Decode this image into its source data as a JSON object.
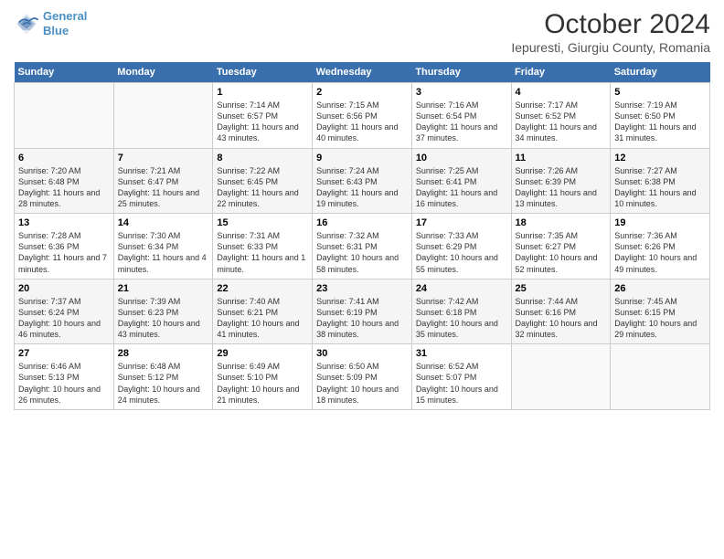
{
  "logo": {
    "line1": "General",
    "line2": "Blue"
  },
  "title": "October 2024",
  "subtitle": "Iepuresti, Giurgiu County, Romania",
  "headers": [
    "Sunday",
    "Monday",
    "Tuesday",
    "Wednesday",
    "Thursday",
    "Friday",
    "Saturday"
  ],
  "weeks": [
    [
      {
        "day": "",
        "info": ""
      },
      {
        "day": "",
        "info": ""
      },
      {
        "day": "1",
        "info": "Sunrise: 7:14 AM\nSunset: 6:57 PM\nDaylight: 11 hours and 43 minutes."
      },
      {
        "day": "2",
        "info": "Sunrise: 7:15 AM\nSunset: 6:56 PM\nDaylight: 11 hours and 40 minutes."
      },
      {
        "day": "3",
        "info": "Sunrise: 7:16 AM\nSunset: 6:54 PM\nDaylight: 11 hours and 37 minutes."
      },
      {
        "day": "4",
        "info": "Sunrise: 7:17 AM\nSunset: 6:52 PM\nDaylight: 11 hours and 34 minutes."
      },
      {
        "day": "5",
        "info": "Sunrise: 7:19 AM\nSunset: 6:50 PM\nDaylight: 11 hours and 31 minutes."
      }
    ],
    [
      {
        "day": "6",
        "info": "Sunrise: 7:20 AM\nSunset: 6:48 PM\nDaylight: 11 hours and 28 minutes."
      },
      {
        "day": "7",
        "info": "Sunrise: 7:21 AM\nSunset: 6:47 PM\nDaylight: 11 hours and 25 minutes."
      },
      {
        "day": "8",
        "info": "Sunrise: 7:22 AM\nSunset: 6:45 PM\nDaylight: 11 hours and 22 minutes."
      },
      {
        "day": "9",
        "info": "Sunrise: 7:24 AM\nSunset: 6:43 PM\nDaylight: 11 hours and 19 minutes."
      },
      {
        "day": "10",
        "info": "Sunrise: 7:25 AM\nSunset: 6:41 PM\nDaylight: 11 hours and 16 minutes."
      },
      {
        "day": "11",
        "info": "Sunrise: 7:26 AM\nSunset: 6:39 PM\nDaylight: 11 hours and 13 minutes."
      },
      {
        "day": "12",
        "info": "Sunrise: 7:27 AM\nSunset: 6:38 PM\nDaylight: 11 hours and 10 minutes."
      }
    ],
    [
      {
        "day": "13",
        "info": "Sunrise: 7:28 AM\nSunset: 6:36 PM\nDaylight: 11 hours and 7 minutes."
      },
      {
        "day": "14",
        "info": "Sunrise: 7:30 AM\nSunset: 6:34 PM\nDaylight: 11 hours and 4 minutes."
      },
      {
        "day": "15",
        "info": "Sunrise: 7:31 AM\nSunset: 6:33 PM\nDaylight: 11 hours and 1 minute."
      },
      {
        "day": "16",
        "info": "Sunrise: 7:32 AM\nSunset: 6:31 PM\nDaylight: 10 hours and 58 minutes."
      },
      {
        "day": "17",
        "info": "Sunrise: 7:33 AM\nSunset: 6:29 PM\nDaylight: 10 hours and 55 minutes."
      },
      {
        "day": "18",
        "info": "Sunrise: 7:35 AM\nSunset: 6:27 PM\nDaylight: 10 hours and 52 minutes."
      },
      {
        "day": "19",
        "info": "Sunrise: 7:36 AM\nSunset: 6:26 PM\nDaylight: 10 hours and 49 minutes."
      }
    ],
    [
      {
        "day": "20",
        "info": "Sunrise: 7:37 AM\nSunset: 6:24 PM\nDaylight: 10 hours and 46 minutes."
      },
      {
        "day": "21",
        "info": "Sunrise: 7:39 AM\nSunset: 6:23 PM\nDaylight: 10 hours and 43 minutes."
      },
      {
        "day": "22",
        "info": "Sunrise: 7:40 AM\nSunset: 6:21 PM\nDaylight: 10 hours and 41 minutes."
      },
      {
        "day": "23",
        "info": "Sunrise: 7:41 AM\nSunset: 6:19 PM\nDaylight: 10 hours and 38 minutes."
      },
      {
        "day": "24",
        "info": "Sunrise: 7:42 AM\nSunset: 6:18 PM\nDaylight: 10 hours and 35 minutes."
      },
      {
        "day": "25",
        "info": "Sunrise: 7:44 AM\nSunset: 6:16 PM\nDaylight: 10 hours and 32 minutes."
      },
      {
        "day": "26",
        "info": "Sunrise: 7:45 AM\nSunset: 6:15 PM\nDaylight: 10 hours and 29 minutes."
      }
    ],
    [
      {
        "day": "27",
        "info": "Sunrise: 6:46 AM\nSunset: 5:13 PM\nDaylight: 10 hours and 26 minutes."
      },
      {
        "day": "28",
        "info": "Sunrise: 6:48 AM\nSunset: 5:12 PM\nDaylight: 10 hours and 24 minutes."
      },
      {
        "day": "29",
        "info": "Sunrise: 6:49 AM\nSunset: 5:10 PM\nDaylight: 10 hours and 21 minutes."
      },
      {
        "day": "30",
        "info": "Sunrise: 6:50 AM\nSunset: 5:09 PM\nDaylight: 10 hours and 18 minutes."
      },
      {
        "day": "31",
        "info": "Sunrise: 6:52 AM\nSunset: 5:07 PM\nDaylight: 10 hours and 15 minutes."
      },
      {
        "day": "",
        "info": ""
      },
      {
        "day": "",
        "info": ""
      }
    ]
  ]
}
